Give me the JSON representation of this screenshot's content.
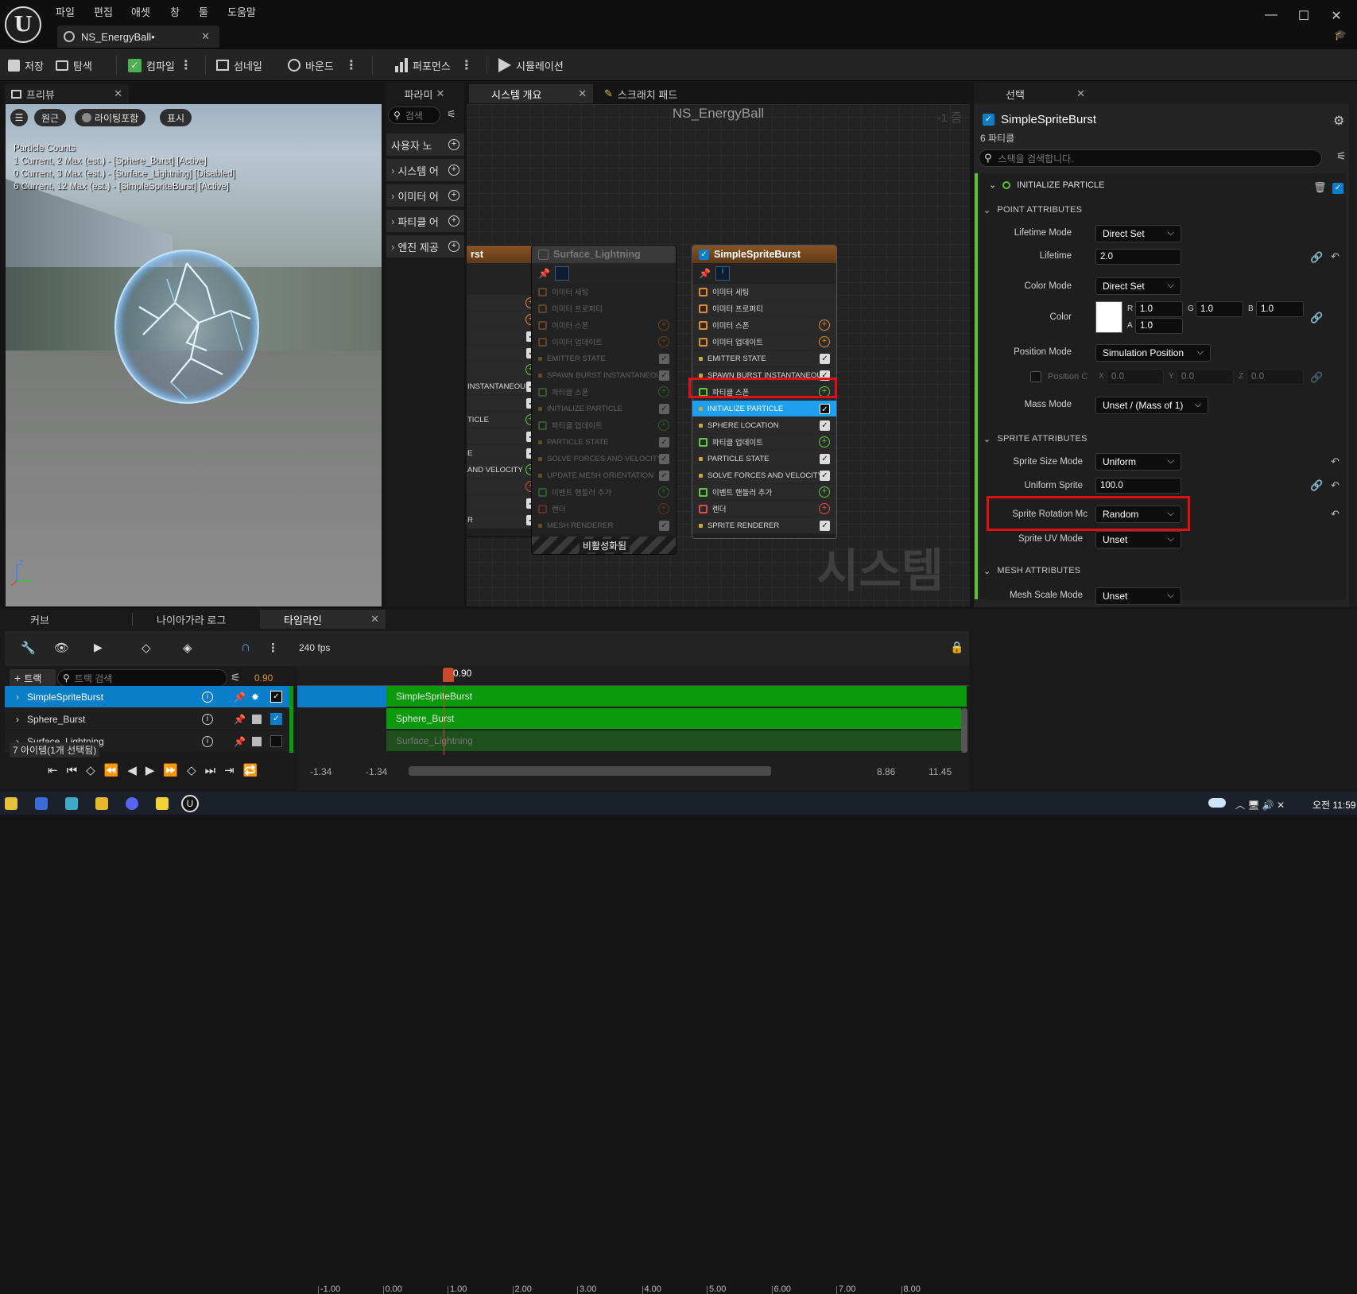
{
  "menu": [
    "파일",
    "편집",
    "애셋",
    "창",
    "툴",
    "도움말"
  ],
  "document_tab": "NS_EnergyBall•",
  "toolbar": {
    "save": "저장",
    "browse": "탐색",
    "compile": "컴파일",
    "thumbnail": "섬네일",
    "bounds": "바운드",
    "performance": "퍼포먼스",
    "simulation": "시뮬레이션"
  },
  "preview": {
    "tab": "프리뷰",
    "perspective": "원근",
    "lighting": "라이팅포함",
    "show": "표시",
    "stats": [
      "Particle Counts",
      "1 Current, 2 Max (est.) - [Sphere_Burst] [Active]",
      "0 Current, 3 Max (est.) - [Surface_Lightning] [Disabled]",
      "6 Current, 12 Max (est.) - [SimpleSpriteBurst] [Active]"
    ]
  },
  "palette": {
    "tab": "파라미",
    "search_placeholder": "검색",
    "items": [
      "사용자 노",
      "시스템 어",
      "이미터 어",
      "파티클 어",
      "엔진 제공"
    ]
  },
  "graph": {
    "tab_overview": "시스템 개요",
    "tab_scratch": "스크래치 패드",
    "title": "NS_EnergyBall",
    "zoom": "-1 줌",
    "watermark": "시스템",
    "left_node": {
      "title": "rst",
      "rows": [
        "",
        "",
        "",
        "",
        "",
        "INSTANTANEOUS",
        "",
        "TICLE",
        "",
        "E",
        "AND VELOCITY",
        "",
        "",
        "R"
      ]
    },
    "lightning_node": {
      "title": "Surface_Lightning",
      "footer": "비활성화됨",
      "rows": [
        "이미터 세팅",
        "이미터 프로퍼티",
        "이미터 스폰",
        "이미터 업데이트",
        "EMITTER STATE",
        "SPAWN BURST INSTANTANEOUS",
        "파티클 스폰",
        "INITIALIZE PARTICLE",
        "파티클 업데이트",
        "PARTICLE STATE",
        "SOLVE FORCES AND VELOCITY",
        "UPDATE MESH ORIENTATION",
        "이벤트 핸들러 추가",
        "렌더",
        "MESH RENDERER"
      ]
    },
    "sprite_node": {
      "title": "SimpleSpriteBurst",
      "rows": [
        "이미터 세팅",
        "이미터 프로퍼티",
        "이미터 스폰",
        "이미터 업데이트",
        "EMITTER STATE",
        "SPAWN BURST INSTANTANEOUS",
        "파티클 스폰",
        "INITIALIZE PARTICLE",
        "SPHERE LOCATION",
        "파티클 업데이트",
        "PARTICLE STATE",
        "SOLVE FORCES AND VELOCITY",
        "이벤트 핸들러 추가",
        "렌더",
        "SPRITE RENDERER"
      ]
    }
  },
  "details": {
    "tab": "선택",
    "title": "SimpleSpriteBurst",
    "subtitle": "6 파티클",
    "search_placeholder": "스택을 검색합니다.",
    "module": "INITIALIZE PARTICLE",
    "section_point": "POINT ATTRIBUTES",
    "section_sprite": "SPRITE ATTRIBUTES",
    "section_mesh": "MESH ATTRIBUTES",
    "lifetime_mode_label": "Lifetime Mode",
    "lifetime_mode": "Direct Set",
    "lifetime_label": "Lifetime",
    "lifetime": "2.0",
    "color_mode_label": "Color Mode",
    "color_mode": "Direct Set",
    "color_label": "Color",
    "color_r": "1.0",
    "color_g": "1.0",
    "color_b": "1.0",
    "color_a": "1.0",
    "position_mode_label": "Position Mode",
    "position_mode": "Simulation Position",
    "position_offset_label": "Position C",
    "pos_x": "0.0",
    "pos_y": "0.0",
    "pos_z": "0.0",
    "mass_mode_label": "Mass Mode",
    "mass_mode": "Unset / (Mass of 1)",
    "sprite_size_mode_label": "Sprite Size Mode",
    "sprite_size_mode": "Uniform",
    "uniform_sprite_label": "Uniform Sprite",
    "uniform_sprite": "100.0",
    "sprite_rotation_label": "Sprite Rotation Mc",
    "sprite_rotation": "Random",
    "sprite_uv_label": "Sprite UV Mode",
    "sprite_uv": "Unset",
    "mesh_scale_label": "Mesh Scale Mode",
    "mesh_scale": "Unset"
  },
  "bottom": {
    "tab_curve": "커브",
    "tab_log": "나이아가라 로그",
    "tab_timeline": "타임라인",
    "fps": "240 fps",
    "add_track": "트랙",
    "track_search_placeholder": "트랙 검색",
    "time_value": "0.90",
    "playhead": "0.90",
    "tracks": [
      "SimpleSpriteBurst",
      "Sphere_Burst",
      "Surface_Lightning"
    ],
    "items_status": "7 아이템(1개 선택됨)",
    "ruler": [
      "-1.00",
      "0.00",
      "1.00",
      "2.00",
      "3.00",
      "4.00",
      "5.00",
      "6.00",
      "7.00",
      "8.00"
    ],
    "range_start": "-1.34",
    "range_start2": "-1.34",
    "range_end": "8.86",
    "range_end2": "11.45"
  },
  "taskbar": {
    "clock": "오전 11:59"
  },
  "colors": {
    "accent_blue": "#0a7ec9",
    "selection_highlight": "#1ea0f0",
    "annotation_red": "#e01010",
    "track_green": "#0b9a0b",
    "node_header_orange": "#7a4a22"
  }
}
